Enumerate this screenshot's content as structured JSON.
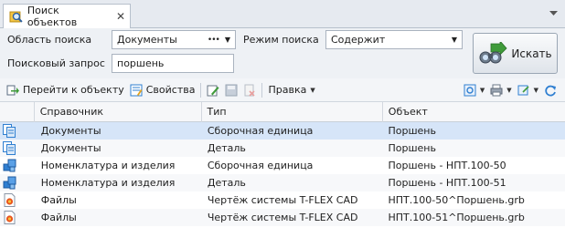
{
  "tab": {
    "title": "Поиск объектов",
    "close": "✕"
  },
  "search": {
    "area_label": "Область поиска",
    "area_value": "Документы",
    "area_more": "•••",
    "mode_label": "Режим поиска",
    "mode_value": "Содержит",
    "query_label": "Поисковый запрос",
    "query_value": "поршень",
    "button_label": "Искать"
  },
  "toolbar": {
    "goto_label": "Перейти к объекту",
    "props_label": "Свойства",
    "edit_label": "Правка"
  },
  "table": {
    "headers": [
      "Справочник",
      "Тип",
      "Объект"
    ],
    "rows": [
      {
        "icon": "documents-icon",
        "ref": "Документы",
        "type": "Сборочная единица",
        "obj": "Поршень"
      },
      {
        "icon": "documents-icon",
        "ref": "Документы",
        "type": "Деталь",
        "obj": "Поршень"
      },
      {
        "icon": "nomenclature-icon",
        "ref": "Номенклатура и изделия",
        "type": "Сборочная единица",
        "obj": "Поршень - НПТ.100-50"
      },
      {
        "icon": "nomenclature-icon",
        "ref": "Номенклатура и изделия",
        "type": "Деталь",
        "obj": "Поршень - НПТ.100-51"
      },
      {
        "icon": "tflex-file-icon",
        "ref": "Файлы",
        "type": "Чертёж системы T-FLEX CAD",
        "obj": "НПТ.100-50^Поршень.grb"
      },
      {
        "icon": "tflex-file-icon",
        "ref": "Файлы",
        "type": "Чертёж системы T-FLEX CAD",
        "obj": "НПТ.100-51^Поршень.grb"
      }
    ]
  },
  "colors": {
    "selection": "#d6e5f8",
    "accent_green": "#3f9b3a",
    "blue_icon": "#2f7fd1"
  }
}
